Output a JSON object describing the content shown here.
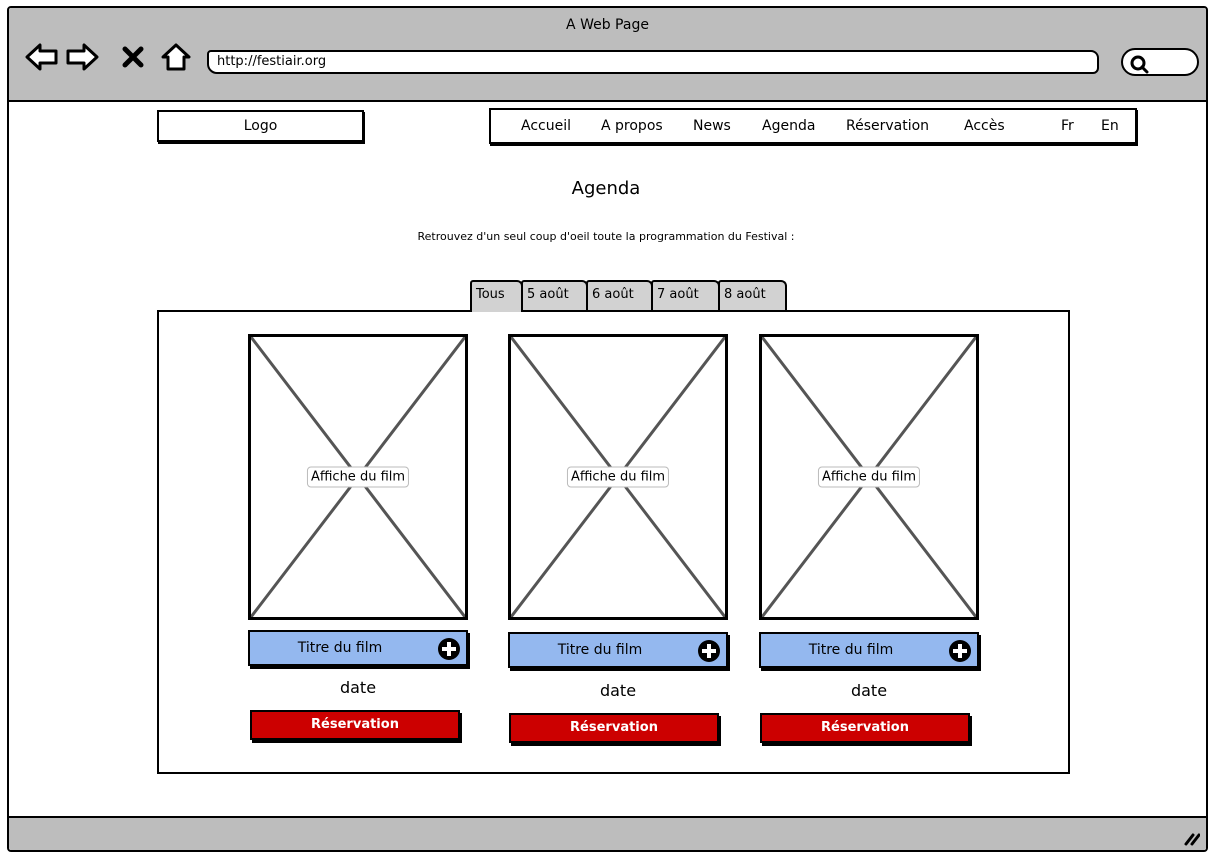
{
  "browser": {
    "window_title": "A Web Page",
    "url": "http://festiair.org",
    "icons": [
      "back-arrow-icon",
      "forward-arrow-icon",
      "close-icon",
      "home-icon",
      "search-icon",
      "resize-grip-icon"
    ]
  },
  "header": {
    "logo": "Logo",
    "nav": [
      "Accueil",
      "A propos",
      "News",
      "Agenda",
      "Réservation",
      "Accès",
      "Fr",
      "En"
    ]
  },
  "main": {
    "title": "Agenda",
    "intro": "Retrouvez d'un seul coup d'oeil toute la programmation du Festival :",
    "tabs": [
      "Tous",
      "5 août",
      "6 août",
      "7 août",
      "8 août"
    ],
    "active_tab": "Tous",
    "films": [
      {
        "poster_label": "Affiche du film",
        "title": "Titre du film",
        "date": "date",
        "button": "Réservation"
      },
      {
        "poster_label": "Affiche du film",
        "title": "Titre du film",
        "date": "date",
        "button": "Réservation"
      },
      {
        "poster_label": "Affiche du film",
        "title": "Titre du film",
        "date": "date",
        "button": "Réservation"
      }
    ]
  },
  "colors": {
    "chrome_gray": "#bdbdbd",
    "title_bar_blue": "#94b8ef",
    "button_red": "#cc0000",
    "tab_gray": "#d2d2d2"
  }
}
